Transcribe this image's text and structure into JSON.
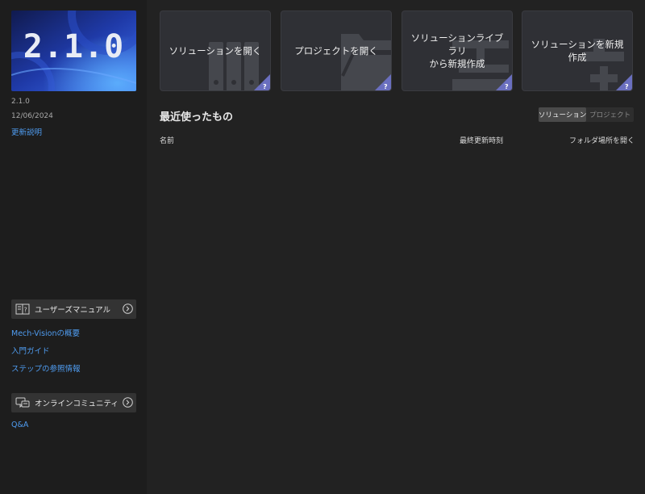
{
  "sidebar": {
    "banner_version": "2.1.0",
    "version": "2.1.0",
    "date": "12/06/2024",
    "release_notes": "更新説明",
    "manual_box": {
      "label": "ユーザーズマニュアル",
      "icon": "book-icon"
    },
    "manual_links": [
      "Mech-Visionの概要",
      "入門ガイド",
      "ステップの参照情報"
    ],
    "community_box": {
      "label": "オンラインコミュニティ",
      "icon": "chat-icon"
    },
    "community_links": [
      "Q&A"
    ]
  },
  "cards": [
    {
      "label": "ソリューションを開く",
      "icon": "binders-icon"
    },
    {
      "label": "プロジェクトを開く",
      "icon": "folder-icon"
    },
    {
      "label": "ソリューションライブラリ\nから新規作成",
      "icon": "library-icon"
    },
    {
      "label": "ソリューションを新規\n作成",
      "icon": "new-solution-icon"
    }
  ],
  "recent": {
    "title": "最近使ったもの",
    "toggle": [
      "ソリューション",
      "プロジェクト"
    ],
    "active_toggle": "ソリューション",
    "columns": [
      "名前",
      "最終更新時刻",
      "フォルダ場所を開く"
    ]
  },
  "colors": {
    "accent_link": "#4f9cf0",
    "help_badge": "#6a6fbf",
    "background": "#222222",
    "sidebar": "#1d1d1d"
  }
}
